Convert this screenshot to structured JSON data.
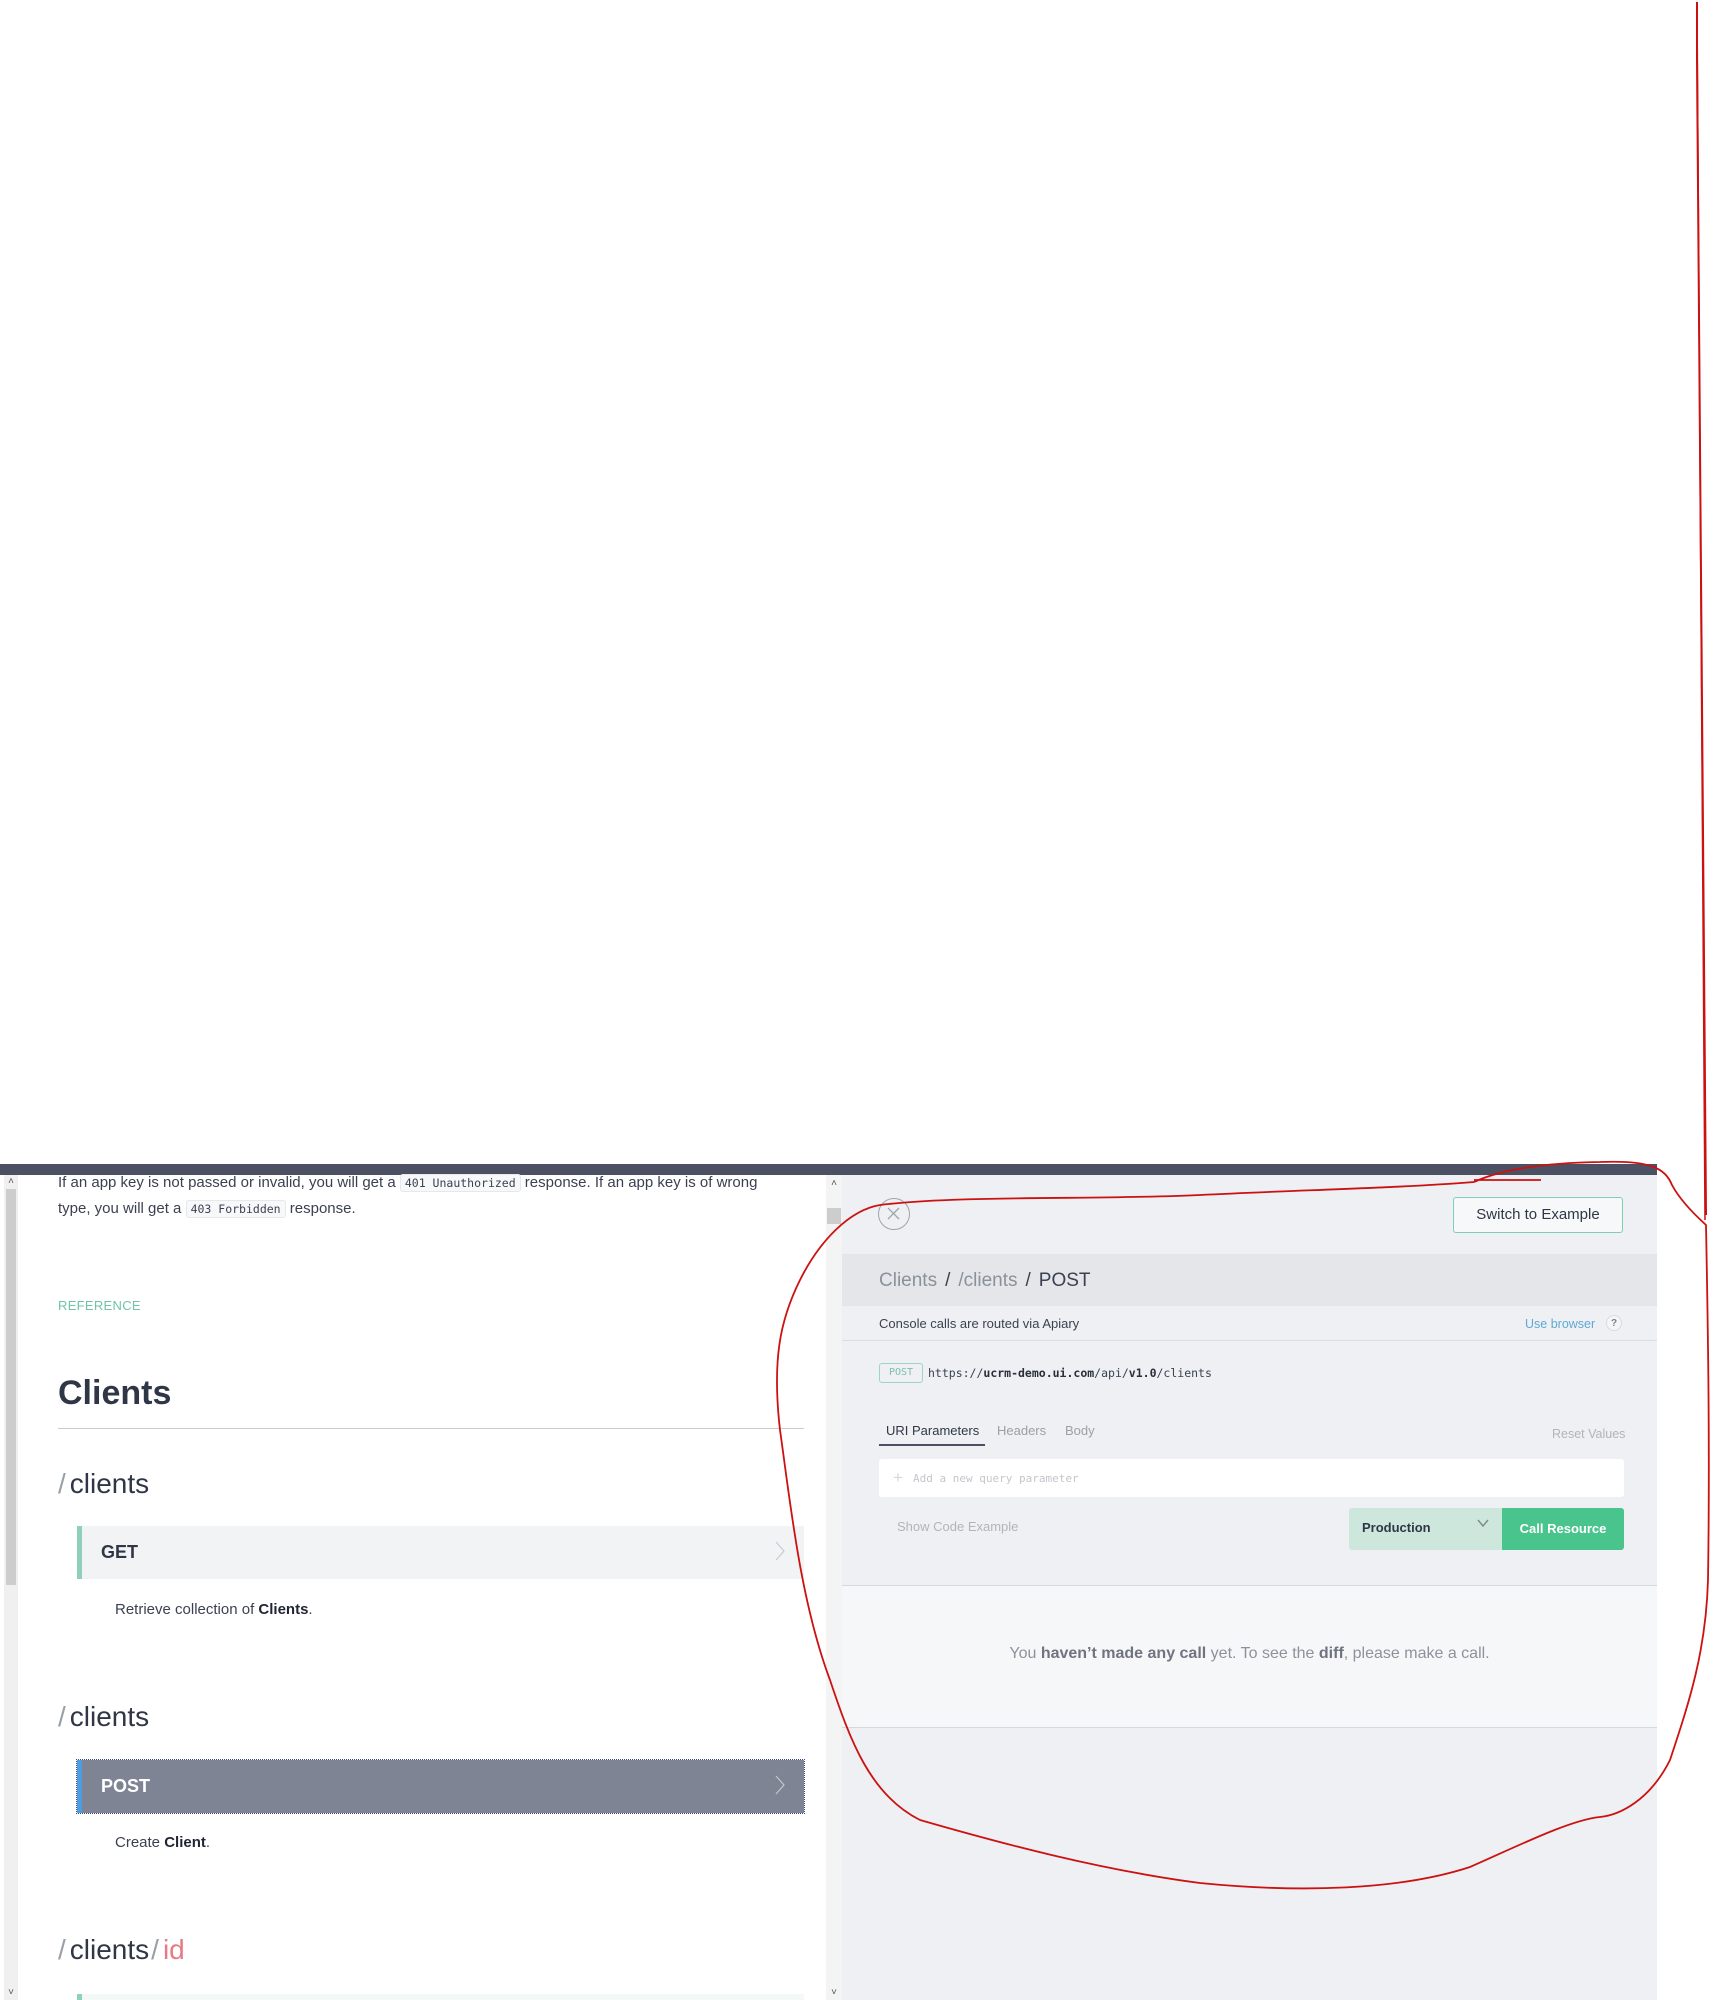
{
  "doc": {
    "intro": {
      "line1_pre": "If an app key is not passed or invalid, you will get a ",
      "line1_code": "401 Unauthorized",
      "line1_post": " response. If an app key is of wrong",
      "line2_pre": "type, you will get a ",
      "line2_code": "403 Forbidden",
      "line2_post": " response."
    },
    "section_label": "REFERENCE",
    "group_title": "Clients",
    "resources": [
      {
        "slash": "/",
        "path": "clients",
        "method": "GET",
        "desc_pre": "Retrieve collection of ",
        "desc_bold": "Clients",
        "desc_post": "."
      },
      {
        "slash": "/",
        "path": "clients",
        "method": "POST",
        "active": true,
        "desc_pre": "Create ",
        "desc_bold": "Client",
        "desc_post": "."
      },
      {
        "slash": "/",
        "path": "clients",
        "slash2": "/",
        "param": "id"
      }
    ]
  },
  "console": {
    "switch_button": "Switch to Example",
    "breadcrumb": {
      "group": "Clients",
      "sep": "/",
      "resource": "/clients",
      "method": "POST"
    },
    "routing_text": "Console calls are routed via Apiary",
    "use_browser": "Use browser",
    "help": "?",
    "method_badge": "POST",
    "url": {
      "scheme": "https://",
      "host": "ucrm-demo.ui.com",
      "path1": "/api/",
      "version": "v1.0",
      "path2": "/clients"
    },
    "tabs": [
      {
        "label": "URI Parameters",
        "active": true
      },
      {
        "label": "Headers",
        "active": false
      },
      {
        "label": "Body",
        "active": false
      }
    ],
    "reset_values": "Reset Values",
    "query_placeholder": "Add a new query parameter",
    "query_value": "",
    "show_code": "Show Code Example",
    "environment": "Production",
    "call_button": "Call Resource",
    "diff_message": {
      "p1": "You ",
      "b1": "haven’t made any call",
      "p2": " yet. To see the ",
      "b2": "diff",
      "p3": ", please make a call."
    }
  },
  "colors": {
    "accent_green": "#48c48c",
    "get_border": "#8ed1b8",
    "active_row": "#7e8493",
    "active_border": "#4d9de0",
    "param_red": "#e77a84",
    "link_blue": "#5fa9d4",
    "annotation_red": "#cc1111"
  }
}
